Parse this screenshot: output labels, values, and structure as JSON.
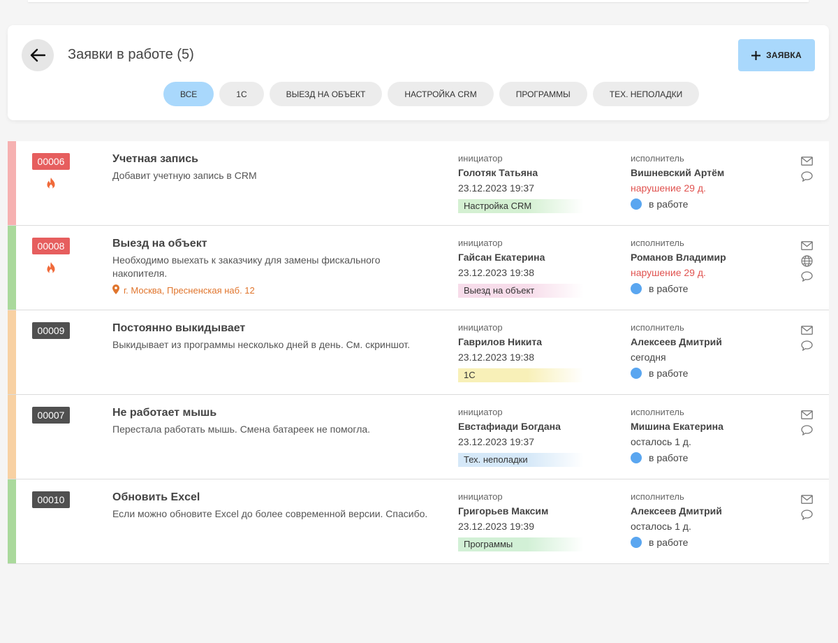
{
  "header": {
    "title": "Заявки в работе (5)",
    "add_label": "ЗАЯВКА",
    "filters": [
      "ВСЕ",
      "1С",
      "ВЫЕЗД НА ОБЪЕКТ",
      "НАСТРОЙКА CRM",
      "ПРОГРАММЫ",
      "ТЕХ. НЕПОЛАДКИ"
    ],
    "active_filter": "ВСЕ"
  },
  "labels": {
    "initiator": "инициатор",
    "executor": "исполнитель"
  },
  "colors": {
    "accent": "#a9d8fc",
    "stripe_red": "#f6b1b1",
    "stripe_green": "#aad99c",
    "stripe_orange": "#f8d1a3",
    "badge_red": "#e65e5e",
    "badge_dark": "#505050",
    "status_dot": "#5aa6f0"
  },
  "tickets": [
    {
      "id": "00006",
      "badge": "red",
      "urgent": true,
      "stripe": "#f6b1b1",
      "title": "Учетная запись",
      "desc": "Добавит учетную запись в CRM",
      "address": "",
      "initiator": "Голотяк Татьяна",
      "date": "23.12.2023 19:37",
      "category": "Настройка CRM",
      "category_color": "#d4f0d2",
      "executor": "Вишневский Артём",
      "deadline": "нарушение 29 д.",
      "deadline_warn": true,
      "status": "в работе",
      "icons": [
        "mail-icon",
        "comment-icon"
      ]
    },
    {
      "id": "00008",
      "badge": "red",
      "urgent": true,
      "stripe": "#aad99c",
      "title": "Выезд на объект",
      "desc": "Необходимо выехать к заказчику для замены фискального накопителя.",
      "address": "г. Москва, Пресненская наб. 12",
      "initiator": "Гайсан Екатерина",
      "date": "23.12.2023 19:38",
      "category": "Выезд на объект",
      "category_color": "#f7dcea",
      "executor": "Романов Владимир",
      "deadline": "нарушение 29 д.",
      "deadline_warn": true,
      "status": "в работе",
      "icons": [
        "mail-icon",
        "globe-icon",
        "comment-icon"
      ]
    },
    {
      "id": "00009",
      "badge": "dark",
      "urgent": false,
      "stripe": "#f8d1a3",
      "title": "Постоянно выкидывает",
      "desc": "Выкидывает из программы несколько дней в день. См. скриншот.",
      "address": "",
      "initiator": "Гаврилов Никита",
      "date": "23.12.2023 19:38",
      "category": "1С",
      "category_color": "#f8f0b8",
      "executor": "Алексеев Дмитрий",
      "deadline": "сегодня",
      "deadline_warn": false,
      "status": "в работе",
      "icons": [
        "mail-icon",
        "comment-icon"
      ]
    },
    {
      "id": "00007",
      "badge": "dark",
      "urgent": false,
      "stripe": "#f8d1a3",
      "title": "Не работает мышь",
      "desc": "Перестала работать мышь. Смена батареек не помогла.",
      "address": "",
      "initiator": "Евстафиади Богдана",
      "date": "23.12.2023 19:37",
      "category": "Тех. неполадки",
      "category_color": "#d5e8f8",
      "executor": "Мишина Екатерина",
      "deadline": "осталось 1 д.",
      "deadline_warn": false,
      "status": "в работе",
      "icons": [
        "mail-icon",
        "comment-icon"
      ]
    },
    {
      "id": "00010",
      "badge": "dark",
      "urgent": false,
      "stripe": "#aad99c",
      "title": "Обновить Excel",
      "desc": "Если можно обновите Excel до более современной версии. Спасибо.",
      "address": "",
      "initiator": "Григорьев Максим",
      "date": "23.12.2023 19:39",
      "category": "Программы",
      "category_color": "#d2f0d6",
      "executor": "Алексеев Дмитрий",
      "deadline": "осталось 1 д.",
      "deadline_warn": false,
      "status": "в работе",
      "icons": [
        "mail-icon",
        "comment-icon"
      ]
    }
  ]
}
